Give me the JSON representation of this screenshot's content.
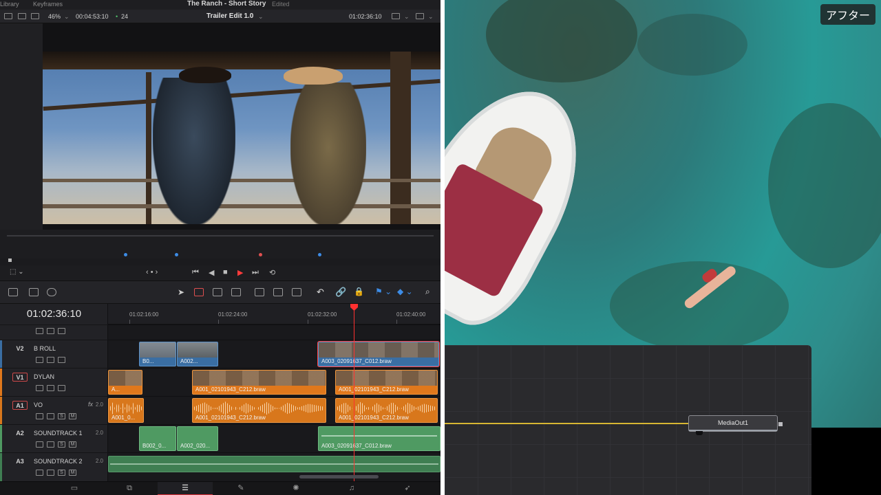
{
  "topbar": {
    "library": "Library",
    "keyframes": "Keyframes",
    "project": "The Ranch - Short Story",
    "status": "Edited"
  },
  "viewer": {
    "zoom": "46%",
    "duration": "00:04:53:10",
    "fps": "24",
    "timeline_name": "Trailer Edit 1.0",
    "timecode": "01:02:36:10"
  },
  "timeline": {
    "timecode": "01:02:36:10",
    "ruler": [
      "01:02:16:00",
      "01:02:24:00",
      "01:02:32:00",
      "01:02:40:00"
    ],
    "tracks": [
      {
        "id": "V2",
        "name": "B ROLL",
        "volume": ""
      },
      {
        "id": "V1",
        "name": "DYLAN",
        "volume": ""
      },
      {
        "id": "A1",
        "name": "VO",
        "fx": "fx",
        "volume": "2.0"
      },
      {
        "id": "A2",
        "name": "SOUNDTRACK 1",
        "volume": "2.0"
      },
      {
        "id": "A3",
        "name": "SOUNDTRACK 2",
        "volume": "2.0"
      }
    ],
    "clips": {
      "v2": [
        "B0...",
        "A002...",
        "A003_02091637_C012.braw"
      ],
      "v1": [
        "A...",
        "A001_02101943_C212.braw",
        "A001_02101943_C212.braw"
      ],
      "a1": [
        "A001_0...",
        "A001_02101943_C212.braw",
        "A001_02101943_C212.braw"
      ],
      "a2": [
        "B002_0...",
        "A002_020...",
        "A003_02091637_C012.braw"
      ]
    },
    "solo": "S",
    "mute": "M"
  },
  "right": {
    "after_label": "アフター",
    "node_name": "MediaOut1"
  },
  "colors": {
    "accent_red": "#ff3030",
    "v_clip": "#3a6ea3",
    "orange_clip": "#e0781c",
    "green_clip": "#4f9a62",
    "wire": "#d8b733"
  }
}
